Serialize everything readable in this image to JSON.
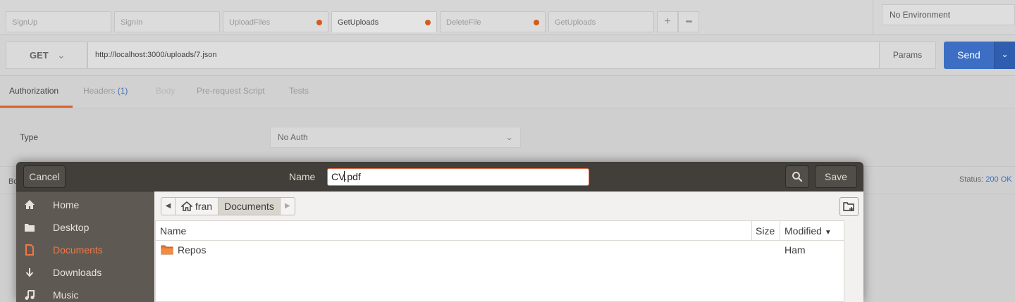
{
  "postman": {
    "tabs": [
      {
        "label": "SignUp",
        "unsaved": false
      },
      {
        "label": "SignIn",
        "unsaved": false
      },
      {
        "label": "UploadFiles",
        "unsaved": true
      },
      {
        "label": "GetUploads",
        "unsaved": true
      },
      {
        "label": "DeleteFile",
        "unsaved": true
      },
      {
        "label": "GetUploads",
        "unsaved": false
      }
    ],
    "new_tab_label": "+",
    "more_label": "•••",
    "environment": "No Environment",
    "method": "GET",
    "url": "http://localhost:3000/uploads/7.json",
    "params_label": "Params",
    "send_label": "Send",
    "request_tabs": {
      "authorization": "Authorization",
      "headers": "Headers",
      "headers_count": "(1)",
      "body": "Body",
      "prerequest": "Pre-request Script",
      "tests": "Tests"
    },
    "type_label": "Type",
    "auth_type": "No Auth",
    "response_fragment": "Bo",
    "status_label": "Status:",
    "status_value": "200 OK",
    "accent_color": "#d9622b",
    "send_color": "#3c6fc4"
  },
  "dialog": {
    "cancel_label": "Cancel",
    "name_label": "Name",
    "filename_before_caret": "CV",
    "filename_after_caret": ".pdf",
    "save_label": "Save",
    "places": [
      {
        "label": "Home",
        "icon": "home-icon"
      },
      {
        "label": "Desktop",
        "icon": "folder-icon"
      },
      {
        "label": "Documents",
        "icon": "document-icon",
        "active": true
      },
      {
        "label": "Downloads",
        "icon": "download-icon"
      },
      {
        "label": "Music",
        "icon": "music-icon"
      }
    ],
    "pathbar": [
      "fran",
      "Documents"
    ],
    "columns": {
      "name": "Name",
      "size": "Size",
      "modified": "Modified"
    },
    "files": [
      {
        "name": "Repos",
        "size": "",
        "modified": "Ham"
      }
    ],
    "accent_color": "#f07746"
  }
}
